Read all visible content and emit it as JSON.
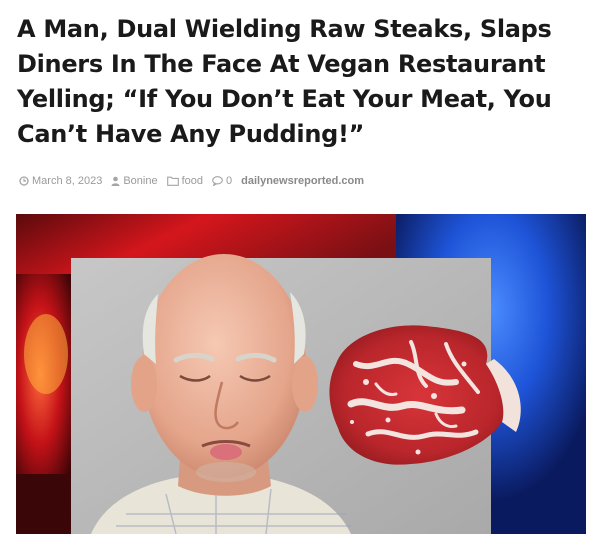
{
  "article": {
    "headline_lines": [
      "A Man, Dual Wielding Raw Steaks, Slaps",
      "Diners In The Face At Vegan Restaurant",
      "Yelling; “If You Don’t Eat Your Meat, You",
      "Can’t Have Any Pudding!”"
    ],
    "meta": {
      "date": "March 8, 2023",
      "author": "Bonine",
      "category": "food",
      "comments": "0",
      "source": "dailynewsreported.com"
    },
    "image": {
      "subjects": [
        "elderly-man-photo",
        "raw-steak-photo",
        "police-lights-background"
      ]
    }
  },
  "colors": {
    "headline": "#1a1a1a",
    "meta": "#9a9a9a",
    "police_red": "#d4161c",
    "police_blue": "#1e54d8",
    "backdrop_gray": "#b9b9b9",
    "steak_red": "#c42a2e"
  }
}
